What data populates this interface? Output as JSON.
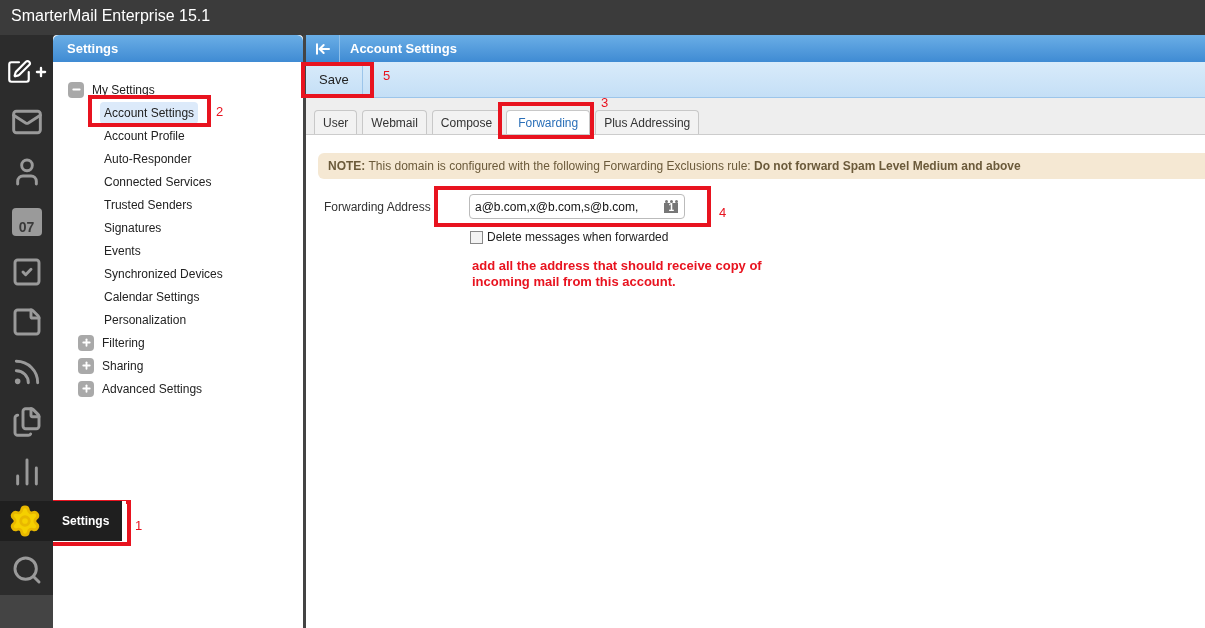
{
  "app_title": "SmarterMail Enterprise 15.1",
  "rail": [
    {
      "kind": "compose",
      "selected": false
    },
    {
      "kind": "mail",
      "selected": false
    },
    {
      "kind": "contacts",
      "selected": false
    },
    {
      "kind": "calendar",
      "label": "07",
      "selected": false
    },
    {
      "kind": "tasks",
      "selected": false
    },
    {
      "kind": "notes",
      "selected": false
    },
    {
      "kind": "feeds",
      "selected": false
    },
    {
      "kind": "files",
      "selected": false
    },
    {
      "kind": "reports",
      "selected": false
    },
    {
      "kind": "settings",
      "label": "Settings",
      "selected": true
    },
    {
      "kind": "search",
      "selected": false
    }
  ],
  "settings_panel": {
    "title": "Settings",
    "tree": [
      {
        "label": "My Settings",
        "expanded": true,
        "children": [
          {
            "label": "Account Settings",
            "selected": true
          },
          {
            "label": "Account Profile",
            "selected": false
          },
          {
            "label": "Auto-Responder",
            "selected": false
          },
          {
            "label": "Connected Services",
            "selected": false
          },
          {
            "label": "Trusted Senders",
            "selected": false
          },
          {
            "label": "Signatures",
            "selected": false
          },
          {
            "label": "Events",
            "selected": false
          },
          {
            "label": "Synchronized Devices",
            "selected": false
          },
          {
            "label": "Calendar Settings",
            "selected": false
          },
          {
            "label": "Personalization",
            "selected": false
          }
        ]
      },
      {
        "label": "Filtering",
        "expanded": false
      },
      {
        "label": "Sharing",
        "expanded": false
      },
      {
        "label": "Advanced Settings",
        "expanded": false
      }
    ]
  },
  "main": {
    "title": "Account Settings",
    "toolbar": [
      "Save"
    ],
    "tabs": [
      {
        "label": "User",
        "selected": false
      },
      {
        "label": "Webmail",
        "selected": false
      },
      {
        "label": "Compose",
        "selected": false
      },
      {
        "label": "Forwarding",
        "selected": true
      },
      {
        "label": "Plus Addressing",
        "selected": false
      }
    ],
    "note": "**NOTE:** This domain is configured with the following Forwarding Exclusions rule: **Do not forward Spam Level Medium and above**",
    "forwarding_address": {
      "label": "Forwarding Address",
      "value": "a@b.com,x@b.com,s@b.com,",
      "icon_text": "1"
    },
    "delete_checkbox": {
      "label": "Delete messages when forwarded",
      "checked": false
    },
    "instruction": "add all the address that should receive copy of incoming mail from this account."
  },
  "annotations": [
    {
      "number": "1"
    },
    {
      "number": "2"
    },
    {
      "number": "3"
    },
    {
      "number": "4"
    },
    {
      "number": "5"
    }
  ]
}
